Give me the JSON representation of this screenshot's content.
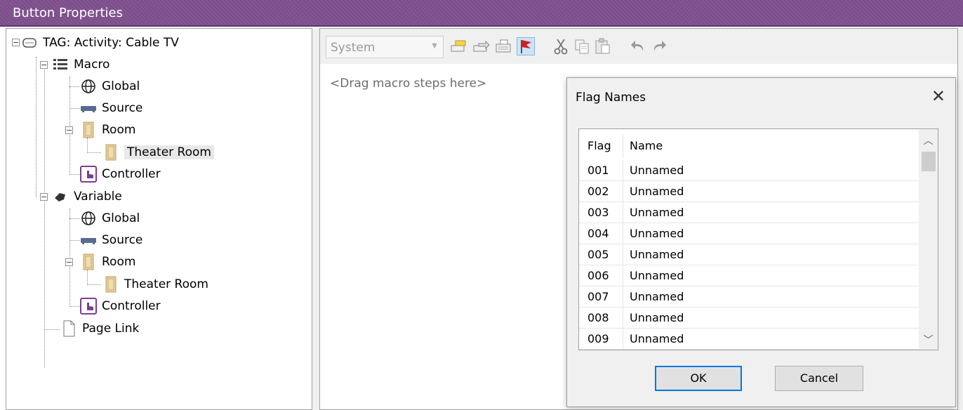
{
  "window": {
    "title": "Button Properties"
  },
  "tree": {
    "root": "TAG: Activity: Cable TV",
    "macro": "Macro",
    "macro_global": "Global",
    "macro_source": "Source",
    "macro_room": "Room",
    "macro_room_child": "Theater Room",
    "macro_controller": "Controller",
    "variable": "Variable",
    "variable_global": "Global",
    "variable_source": "Source",
    "variable_room": "Room",
    "variable_room_child": "Theater Room",
    "variable_controller": "Controller",
    "page_link": "Page Link"
  },
  "toolbar": {
    "combo_value": "System",
    "icons": [
      "new-step-icon",
      "insert-step-icon",
      "edit-step-icon",
      "flag-icon",
      "cut-icon",
      "copy-icon",
      "paste-icon",
      "undo-icon",
      "redo-icon"
    ]
  },
  "editor": {
    "placeholder": "<Drag macro steps here>"
  },
  "dialog": {
    "title": "Flag Names",
    "close_glyph": "✕",
    "columns": {
      "flag": "Flag",
      "name": "Name"
    },
    "rows": [
      {
        "flag": "001",
        "name": "Unnamed"
      },
      {
        "flag": "002",
        "name": "Unnamed"
      },
      {
        "flag": "003",
        "name": "Unnamed"
      },
      {
        "flag": "004",
        "name": "Unnamed"
      },
      {
        "flag": "005",
        "name": "Unnamed"
      },
      {
        "flag": "006",
        "name": "Unnamed"
      },
      {
        "flag": "007",
        "name": "Unnamed"
      },
      {
        "flag": "008",
        "name": "Unnamed"
      },
      {
        "flag": "009",
        "name": "Unnamed"
      }
    ],
    "ok_label": "OK",
    "cancel_label": "Cancel"
  },
  "colors": {
    "titlebar": "#7b4e8a",
    "selection_border": "#0078d7",
    "room_icon": "#e8cf98",
    "controller_icon": "#7a3e8f"
  }
}
